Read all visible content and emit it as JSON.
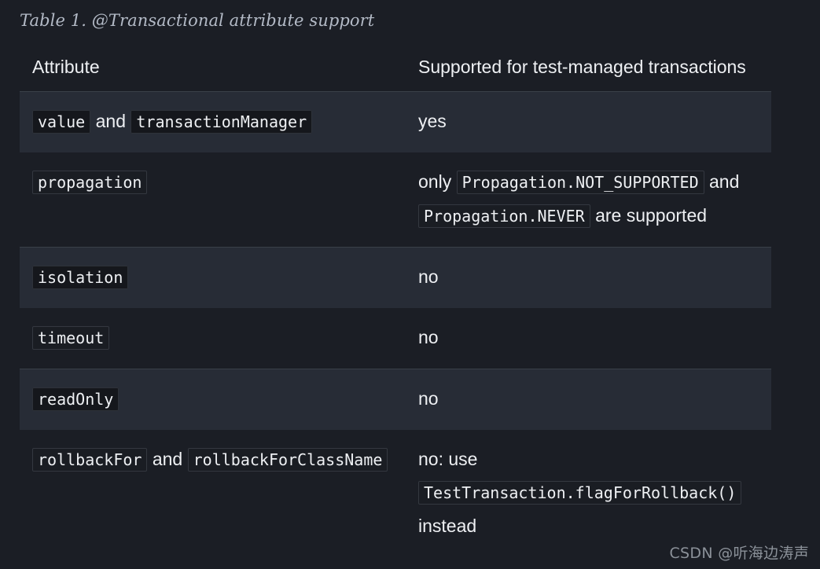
{
  "caption": "Table 1. @Transactional attribute support",
  "table": {
    "headers": [
      "Attribute",
      "Supported for test-managed transactions"
    ],
    "rows": [
      {
        "striped": true,
        "attribute_parts": [
          {
            "type": "code",
            "text": "value"
          },
          {
            "type": "text",
            "text": " and "
          },
          {
            "type": "code",
            "text": "transactionManager"
          }
        ],
        "support_parts": [
          {
            "type": "text",
            "text": "yes"
          }
        ]
      },
      {
        "striped": false,
        "attribute_parts": [
          {
            "type": "code",
            "text": "propagation"
          }
        ],
        "support_parts": [
          {
            "type": "text",
            "text": "only "
          },
          {
            "type": "code",
            "text": "Propagation.NOT_SUPPORTED"
          },
          {
            "type": "text",
            "text": " and "
          },
          {
            "type": "code",
            "text": "Propagation.NEVER"
          },
          {
            "type": "text",
            "text": " are supported"
          }
        ]
      },
      {
        "striped": true,
        "attribute_parts": [
          {
            "type": "code",
            "text": "isolation"
          }
        ],
        "support_parts": [
          {
            "type": "text",
            "text": "no"
          }
        ]
      },
      {
        "striped": false,
        "attribute_parts": [
          {
            "type": "code",
            "text": "timeout"
          }
        ],
        "support_parts": [
          {
            "type": "text",
            "text": "no"
          }
        ]
      },
      {
        "striped": true,
        "attribute_parts": [
          {
            "type": "code",
            "text": "readOnly"
          }
        ],
        "support_parts": [
          {
            "type": "text",
            "text": "no"
          }
        ]
      },
      {
        "striped": false,
        "attribute_parts": [
          {
            "type": "code",
            "text": "rollbackFor"
          },
          {
            "type": "text",
            "text": " and "
          },
          {
            "type": "code",
            "text": "rollbackForClassName"
          }
        ],
        "support_parts": [
          {
            "type": "text",
            "text": "no: use "
          },
          {
            "type": "code",
            "text": "TestTransaction.flagForRollback()"
          },
          {
            "type": "text",
            "text": " instead"
          }
        ]
      }
    ]
  },
  "watermark": "CSDN @听海边涛声",
  "colors": {
    "page_background": "#1b1e25",
    "striped_row_background": "#272c36",
    "striped_row_border": "#3a4049",
    "code_background": "#15171c",
    "code_border": "#343840",
    "text": "#eef0f3",
    "caption_text": "#b3bac6",
    "watermark_text": "#8b9199"
  }
}
